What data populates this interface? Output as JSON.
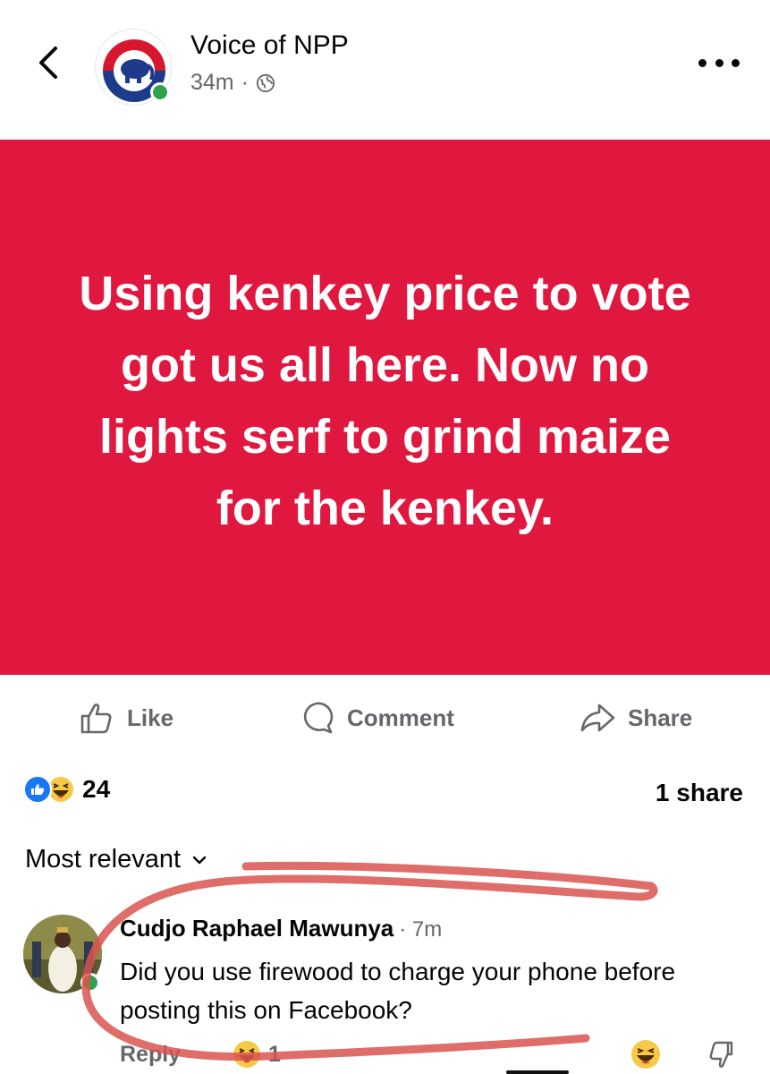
{
  "header": {
    "page_name": "Voice of NPP",
    "time": "34m",
    "separator": "·"
  },
  "post": {
    "text": "Using kenkey price to vote got us all here. Now no lights serf to grind maize for the kenkey.",
    "background": "#e0173e"
  },
  "actions": {
    "like": "Like",
    "comment": "Comment",
    "share": "Share"
  },
  "stats": {
    "reaction_count": "24",
    "shares": "1 share"
  },
  "sort": {
    "label": "Most relevant"
  },
  "comment": {
    "author": "Cudjo Raphael Mawunya",
    "time": "· 7m",
    "text": "Did you use firewood to charge your phone before posting this on Facebook?",
    "reply_label": "Reply",
    "reaction_count": "1"
  },
  "colors": {
    "accent": "#1877f2",
    "online": "#31a24c",
    "muted": "#65676b",
    "annotation": "#d9534f"
  },
  "icons": [
    "back-arrow-icon",
    "globe-icon",
    "more-icon",
    "like-icon",
    "comment-icon",
    "share-icon",
    "haha-icon",
    "chevron-down-icon",
    "dislike-icon"
  ]
}
